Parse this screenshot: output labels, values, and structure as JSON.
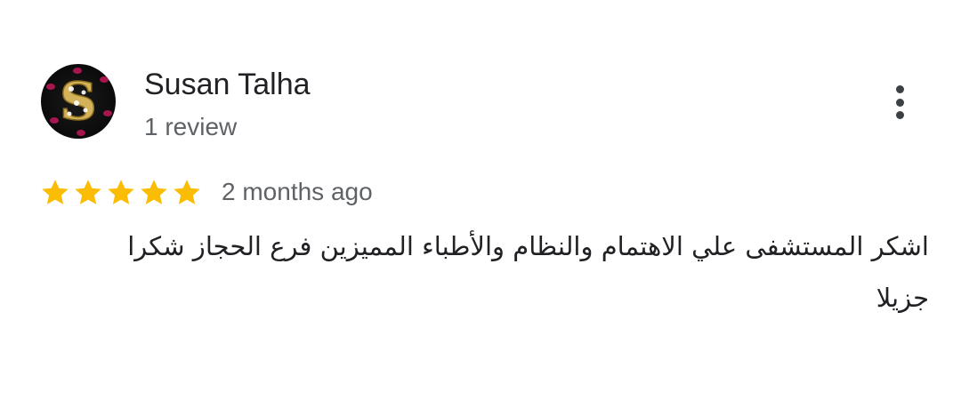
{
  "reviewer": {
    "name": "Susan Talha",
    "review_count": "1 review",
    "avatar_icon": "avatar-letter-s-icon"
  },
  "review": {
    "rating": 5,
    "max_rating": 5,
    "star_color": "#fbbc04",
    "date": "2 months ago",
    "text": "اشكر المستشفى علي الاهتمام والنظام والأطباء المميزين فرع الحجاز شكرا جزيلا"
  },
  "menu": {
    "icon": "more-vert-icon"
  }
}
